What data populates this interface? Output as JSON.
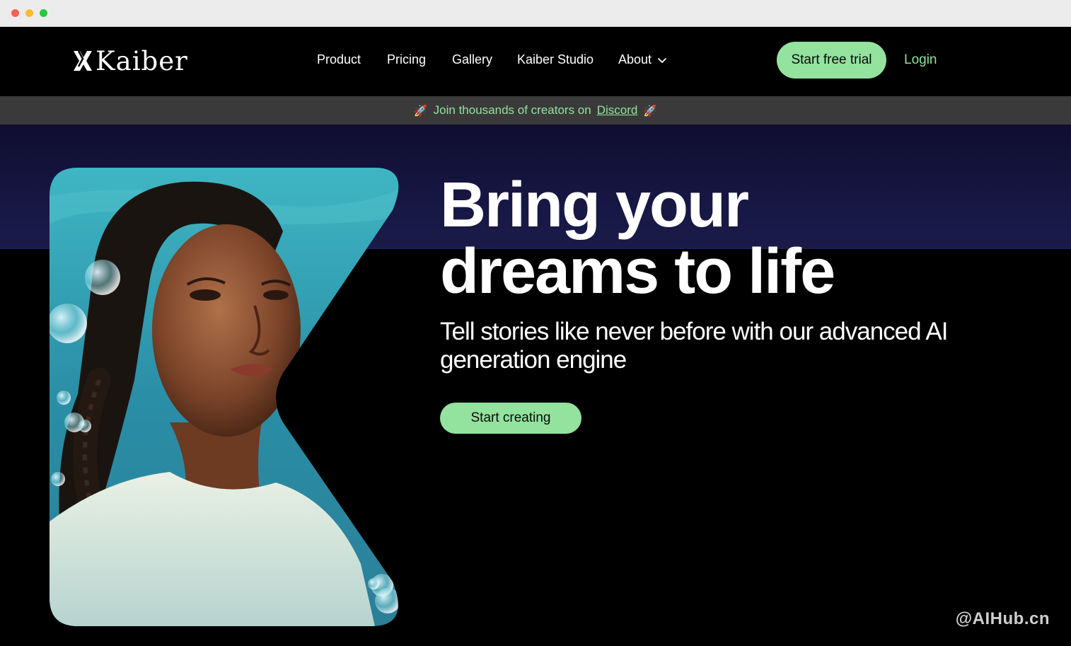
{
  "nav": {
    "logo_text": "Kaiber",
    "items": [
      {
        "label": "Product"
      },
      {
        "label": "Pricing"
      },
      {
        "label": "Gallery"
      },
      {
        "label": "Kaiber Studio"
      },
      {
        "label": "About"
      }
    ],
    "trial_label": "Start free trial",
    "login_label": "Login"
  },
  "banner": {
    "emoji_left": "🚀",
    "text": "Join thousands of creators on",
    "link": "Discord",
    "emoji_right": "🚀"
  },
  "hero": {
    "headline_line1": "Bring your",
    "headline_line2": "dreams to life",
    "subhead": "Tell stories like never before with our advanced AI generation engine",
    "cta_label": "Start creating"
  },
  "watermark": "@AIHub.cn",
  "colors": {
    "accent": "#93e29e",
    "background": "#000000",
    "banner_bg": "#3a3a3a"
  }
}
